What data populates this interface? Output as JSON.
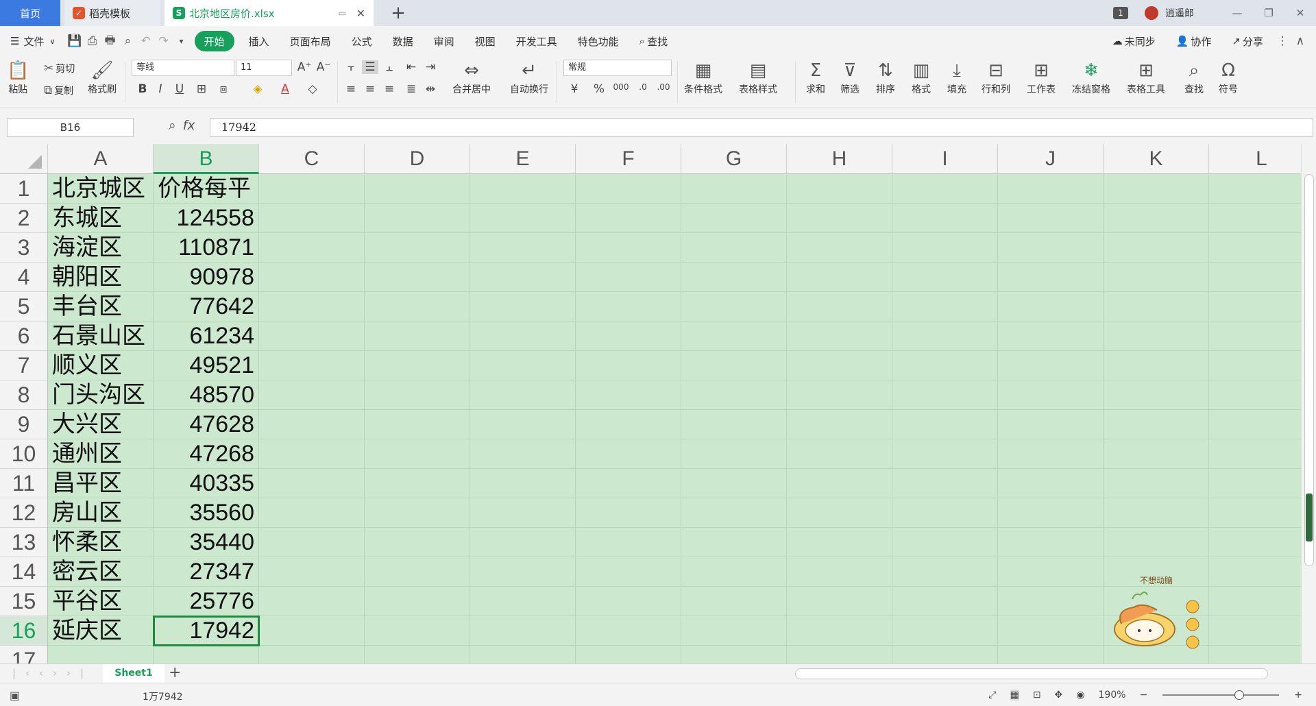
{
  "titlebar": {
    "tabs": [
      {
        "label": "首页"
      },
      {
        "label": "稻壳模板"
      },
      {
        "label": "北京地区房价.xlsx"
      }
    ],
    "notify_count": "1",
    "user_name": "逍遥郎"
  },
  "menu": {
    "file": "文件",
    "items": [
      "开始",
      "插入",
      "页面布局",
      "公式",
      "数据",
      "审阅",
      "视图",
      "开发工具",
      "特色功能"
    ],
    "search": "查找",
    "sync": "未同步",
    "collab": "协作",
    "share": "分享"
  },
  "ribbon": {
    "paste": "粘贴",
    "cut": "剪切",
    "copy": "复制",
    "format_painter": "格式刷",
    "font_name": "等线",
    "font_size": "11",
    "merge_center": "合并居中",
    "wrap_text": "自动换行",
    "number_format": "常规",
    "conditional_format": "条件格式",
    "table_style": "表格样式",
    "sum": "求和",
    "filter": "筛选",
    "sort": "排序",
    "format": "格式",
    "fill": "填充",
    "row_col": "行和列",
    "worksheet": "工作表",
    "freeze": "冻结窗格",
    "table_tools": "表格工具",
    "find": "查找",
    "symbol": "符号"
  },
  "formula_bar": {
    "name_box": "B16",
    "fx": "fx",
    "value": "17942"
  },
  "sheet": {
    "columns": [
      "A",
      "B",
      "C",
      "D",
      "E",
      "F",
      "G",
      "H",
      "I",
      "J",
      "K",
      "L"
    ],
    "selected_column": "B",
    "selected_row": 16,
    "rows": [
      {
        "num": "1",
        "a": "北京城区",
        "b": "价格每平"
      },
      {
        "num": "2",
        "a": "东城区",
        "b": "124558"
      },
      {
        "num": "3",
        "a": "海淀区",
        "b": "110871"
      },
      {
        "num": "4",
        "a": "朝阳区",
        "b": "90978"
      },
      {
        "num": "5",
        "a": "丰台区",
        "b": "77642"
      },
      {
        "num": "6",
        "a": "石景山区",
        "b": "61234"
      },
      {
        "num": "7",
        "a": "顺义区",
        "b": "49521"
      },
      {
        "num": "8",
        "a": "门头沟区",
        "b": "48570"
      },
      {
        "num": "9",
        "a": "大兴区",
        "b": "47628"
      },
      {
        "num": "10",
        "a": "通州区",
        "b": "47268"
      },
      {
        "num": "11",
        "a": "昌平区",
        "b": "40335"
      },
      {
        "num": "12",
        "a": "房山区",
        "b": "35560"
      },
      {
        "num": "13",
        "a": "怀柔区",
        "b": "35440"
      },
      {
        "num": "14",
        "a": "密云区",
        "b": "27347"
      },
      {
        "num": "15",
        "a": "平谷区",
        "b": "25776"
      },
      {
        "num": "16",
        "a": "延庆区",
        "b": "17942"
      },
      {
        "num": "17",
        "a": "",
        "b": ""
      }
    ]
  },
  "mascot_text": "不想动脑",
  "sheet_tabs": {
    "active": "Sheet1"
  },
  "status": {
    "sum": "1万7942",
    "zoom": "190%"
  },
  "colors": {
    "accent": "#16a05c",
    "grid_bg": "#cce8cf",
    "home_tab": "#3b7ae0"
  }
}
